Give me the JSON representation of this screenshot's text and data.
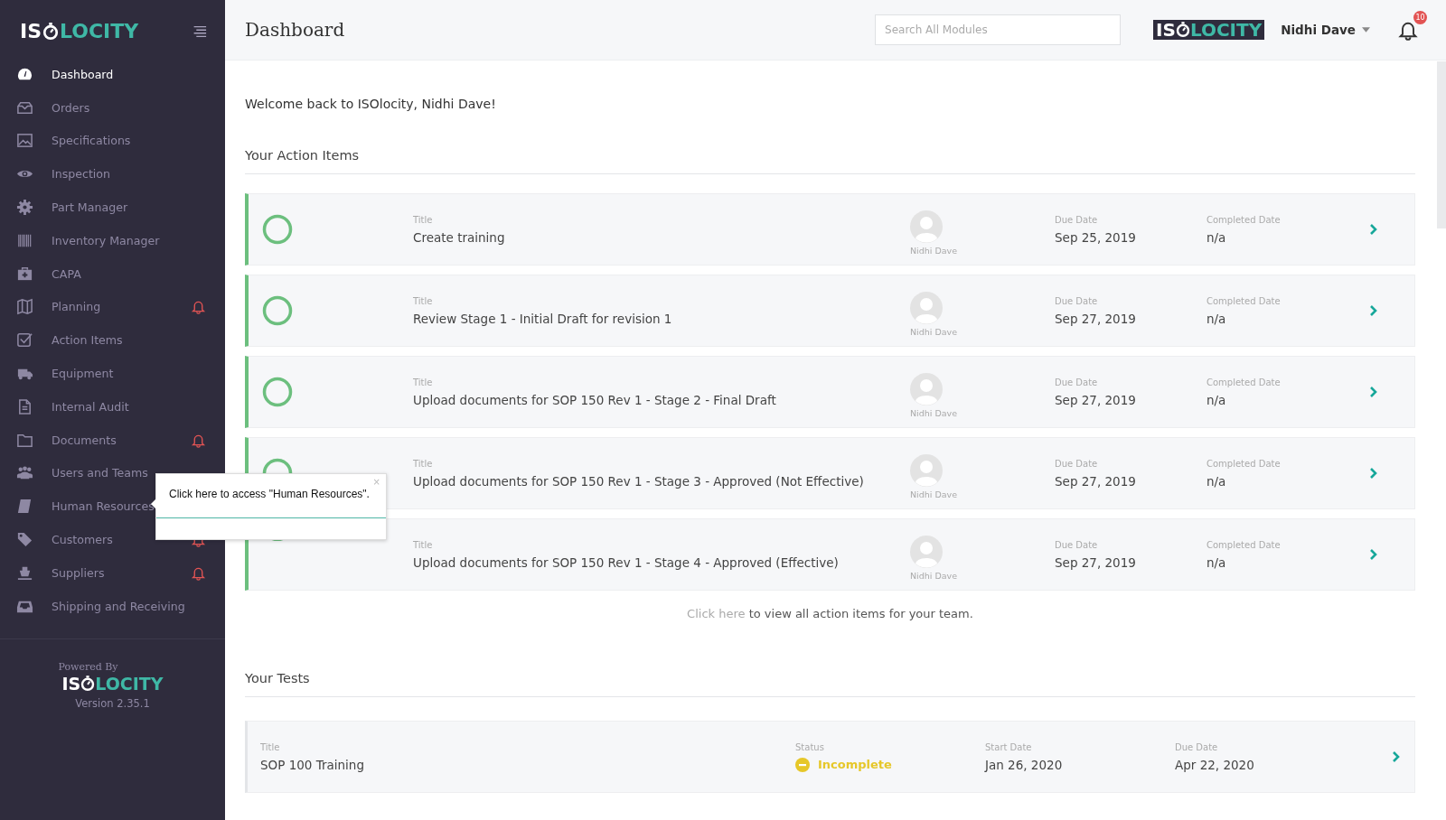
{
  "sidebar": {
    "logo": {
      "left": "IS",
      "right": "LOCITY"
    },
    "items": [
      {
        "label": "Dashboard",
        "selected": true,
        "alert": false
      },
      {
        "label": "Orders",
        "selected": false,
        "alert": false
      },
      {
        "label": "Specifications",
        "selected": false,
        "alert": false
      },
      {
        "label": "Inspection",
        "selected": false,
        "alert": false
      },
      {
        "label": "Part Manager",
        "selected": false,
        "alert": false
      },
      {
        "label": "Inventory Manager",
        "selected": false,
        "alert": false
      },
      {
        "label": "CAPA",
        "selected": false,
        "alert": false
      },
      {
        "label": "Planning",
        "selected": false,
        "alert": true
      },
      {
        "label": "Action Items",
        "selected": false,
        "alert": false
      },
      {
        "label": "Equipment",
        "selected": false,
        "alert": false
      },
      {
        "label": "Internal Audit",
        "selected": false,
        "alert": false
      },
      {
        "label": "Documents",
        "selected": false,
        "alert": true
      },
      {
        "label": "Users and Teams",
        "selected": false,
        "alert": false
      },
      {
        "label": "Human Resources",
        "selected": false,
        "alert": false
      },
      {
        "label": "Customers",
        "selected": false,
        "alert": true
      },
      {
        "label": "Suppliers",
        "selected": false,
        "alert": true
      },
      {
        "label": "Shipping and Receiving",
        "selected": false,
        "alert": false
      }
    ],
    "footer": {
      "powered_by": "Powered By",
      "logo": {
        "left": "IS",
        "right": "LOCITY"
      },
      "version": "Version 2.35.1"
    }
  },
  "header": {
    "title": "Dashboard",
    "search": {
      "placeholder": "Search All Modules"
    },
    "logo": {
      "left": "IS",
      "right": "LOCITY"
    },
    "user": "Nidhi Dave",
    "notifications": "10"
  },
  "tooltip": {
    "text": "Click here to access \"Human Resources\".",
    "close": "×"
  },
  "welcome": "Welcome back to ISOlocity, Nidhi Dave!",
  "action_items": {
    "heading": "Your Action Items",
    "rows": [
      {
        "title_label": "Title",
        "title": "Create training",
        "assignee": "Nidhi Dave",
        "due_label": "Due Date",
        "due": "Sep 25, 2019",
        "completed_label": "Completed Date",
        "completed": "n/a"
      },
      {
        "title_label": "Title",
        "title": "Review Stage 1 - Initial Draft for revision 1",
        "assignee": "Nidhi Dave",
        "due_label": "Due Date",
        "due": "Sep 27, 2019",
        "completed_label": "Completed Date",
        "completed": "n/a"
      },
      {
        "title_label": "Title",
        "title": "Upload documents for SOP 150 Rev 1 - Stage 2 - Final Draft",
        "assignee": "Nidhi Dave",
        "due_label": "Due Date",
        "due": "Sep 27, 2019",
        "completed_label": "Completed Date",
        "completed": "n/a"
      },
      {
        "title_label": "Title",
        "title": "Upload documents for SOP 150 Rev 1 - Stage 3 - Approved (Not Effective)",
        "assignee": "Nidhi Dave",
        "due_label": "Due Date",
        "due": "Sep 27, 2019",
        "completed_label": "Completed Date",
        "completed": "n/a"
      },
      {
        "title_label": "Title",
        "title": "Upload documents for SOP 150 Rev 1 - Stage 4 - Approved (Effective)",
        "assignee": "Nidhi Dave",
        "due_label": "Due Date",
        "due": "Sep 27, 2019",
        "completed_label": "Completed Date",
        "completed": "n/a"
      }
    ],
    "footer_link": "Click here",
    "footer_text": "to view all action items for your team."
  },
  "tests": {
    "heading": "Your Tests",
    "rows": [
      {
        "title_label": "Title",
        "title": "SOP 100 Training",
        "status_label": "Status",
        "status": "Incomplete",
        "start_label": "Start Date",
        "start": "Jan 26, 2020",
        "due_label": "Due Date",
        "due": "Apr 22, 2020"
      }
    ]
  }
}
